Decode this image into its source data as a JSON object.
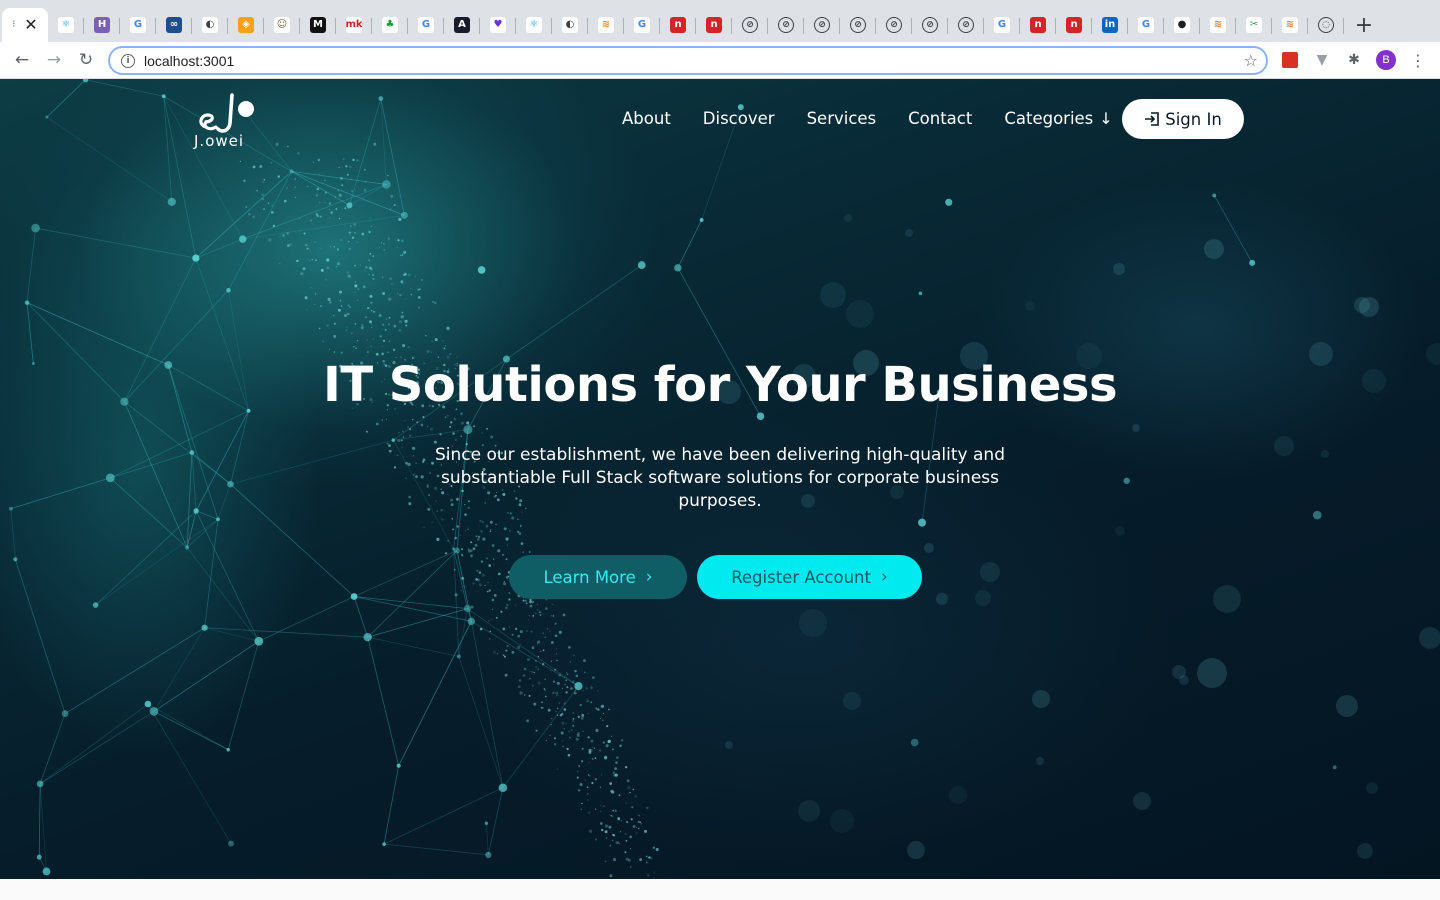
{
  "browser": {
    "url": "localhost:3001",
    "profile_initial": "B",
    "active_tab_close": "✕",
    "new_tab": "+",
    "back": "←",
    "forward": "→",
    "reload": "↻",
    "bookmark_star": "☆",
    "info": "i",
    "tab_favicons": [
      {
        "icon": "react-icon",
        "glyph": "⚛",
        "bg": "#ffffff",
        "fg": "#1d9bd1"
      },
      {
        "icon": "heroku-icon",
        "glyph": "H",
        "bg": "#7b5fb0",
        "fg": "#ffffff"
      },
      {
        "icon": "google-icon",
        "glyph": "G",
        "bg": "#ffffff",
        "fg": "#4285f4"
      },
      {
        "icon": "infinity-icon",
        "glyph": "∞",
        "bg": "#1f4c8f",
        "fg": "#ffffff"
      },
      {
        "icon": "globe-icon",
        "glyph": "◐",
        "bg": "#ffffff",
        "fg": "#3c4043"
      },
      {
        "icon": "bitcoin-icon",
        "glyph": "◈",
        "bg": "#f7a11b",
        "fg": "#ffffff"
      },
      {
        "icon": "robot-icon",
        "glyph": "☺",
        "bg": "#ffffff",
        "fg": "#6b5a3c"
      },
      {
        "icon": "medium-icon",
        "glyph": "M",
        "bg": "#111111",
        "fg": "#ffffff"
      },
      {
        "icon": "mk-icon",
        "glyph": "mk",
        "bg": "#ffffff",
        "fg": "#d6232a"
      },
      {
        "icon": "plant-icon",
        "glyph": "♣",
        "bg": "#ffffff",
        "fg": "#1a9d3b"
      },
      {
        "icon": "google-icon",
        "glyph": "G",
        "bg": "#ffffff",
        "fg": "#4285f4"
      },
      {
        "icon": "angular-icon",
        "glyph": "A",
        "bg": "#1b1b2f",
        "fg": "#ffffff"
      },
      {
        "icon": "heart-icon",
        "glyph": "♥",
        "bg": "#ffffff",
        "fg": "#6a35d6"
      },
      {
        "icon": "react-icon",
        "glyph": "⚛",
        "bg": "#ffffff",
        "fg": "#1d9bd1"
      },
      {
        "icon": "globe-icon",
        "glyph": "◐",
        "bg": "#ffffff",
        "fg": "#3c4043"
      },
      {
        "icon": "stack-icon",
        "glyph": "≋",
        "bg": "#ffffff",
        "fg": "#f48024"
      },
      {
        "icon": "google-icon",
        "glyph": "G",
        "bg": "#ffffff",
        "fg": "#4285f4"
      },
      {
        "icon": "n-red-icon",
        "glyph": "n",
        "bg": "#d6232a",
        "fg": "#ffffff"
      },
      {
        "icon": "n-red-icon",
        "glyph": "n",
        "bg": "#d6232a",
        "fg": "#ffffff"
      },
      {
        "icon": "compass-icon",
        "glyph": "⊘",
        "bg": "ring",
        "fg": "#3c4043"
      },
      {
        "icon": "compass-icon",
        "glyph": "⊘",
        "bg": "ring",
        "fg": "#3c4043"
      },
      {
        "icon": "compass-icon",
        "glyph": "⊘",
        "bg": "ring",
        "fg": "#3c4043"
      },
      {
        "icon": "compass-icon",
        "glyph": "⊘",
        "bg": "ring",
        "fg": "#3c4043"
      },
      {
        "icon": "compass-icon",
        "glyph": "⊘",
        "bg": "ring",
        "fg": "#3c4043"
      },
      {
        "icon": "compass-icon",
        "glyph": "⊘",
        "bg": "ring",
        "fg": "#3c4043"
      },
      {
        "icon": "compass-icon",
        "glyph": "⊘",
        "bg": "ring",
        "fg": "#3c4043"
      },
      {
        "icon": "google-icon",
        "glyph": "G",
        "bg": "#ffffff",
        "fg": "#4285f4"
      },
      {
        "icon": "n-red-icon",
        "glyph": "n",
        "bg": "#d6232a",
        "fg": "#ffffff"
      },
      {
        "icon": "n-red-icon",
        "glyph": "n",
        "bg": "#d6232a",
        "fg": "#ffffff"
      },
      {
        "icon": "linkedin-icon",
        "glyph": "in",
        "bg": "#0a66c2",
        "fg": "#ffffff"
      },
      {
        "icon": "google-icon",
        "glyph": "G",
        "bg": "#ffffff",
        "fg": "#4285f4"
      },
      {
        "icon": "github-icon",
        "glyph": "●",
        "bg": "#ffffff",
        "fg": "#1b1f23"
      },
      {
        "icon": "stack-icon",
        "glyph": "≋",
        "bg": "#ffffff",
        "fg": "#f48024"
      },
      {
        "icon": "tool-icon",
        "glyph": "✂",
        "bg": "#ffffff",
        "fg": "#2e9a4a"
      },
      {
        "icon": "stack-icon",
        "glyph": "≋",
        "bg": "#ffffff",
        "fg": "#f48024"
      },
      {
        "icon": "speech-icon",
        "glyph": "◌",
        "bg": "ring",
        "fg": "#3c4043"
      }
    ]
  },
  "site": {
    "logo_text": "J.owei",
    "nav": {
      "about": "About",
      "discover": "Discover",
      "services": "Services",
      "contact": "Contact",
      "categories": "Categories",
      "categories_arrow": "↓"
    },
    "signin_label": "Sign In",
    "hero": {
      "title": "IT Solutions for Your Business",
      "subtitle": "Since our establishment, we have been delivering high-quality and substantiable Full Stack software solutions for corporate business purposes."
    },
    "buttons": {
      "learn_more": "Learn More",
      "register": "Register Account",
      "chevron": "›"
    },
    "colors": {
      "learn_bg": "#0f5e66",
      "learn_text": "#37e8ef",
      "register_bg": "#00eaf0",
      "register_text": "#0b5a64"
    }
  }
}
